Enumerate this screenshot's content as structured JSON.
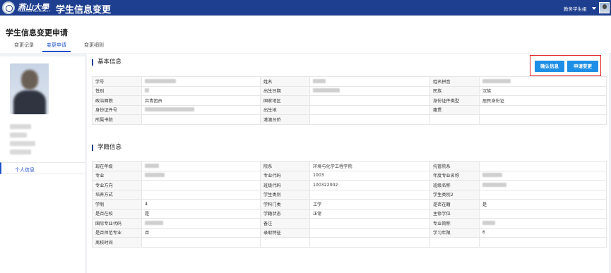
{
  "header": {
    "univ_name_cn": "燕山大學",
    "univ_name_en": "YANSHAN UNIVERSITY",
    "app_title": "学生信息变更",
    "role": "教务学生组"
  },
  "page": {
    "title": "学生信息变更申请",
    "tabs": [
      {
        "label": "变更记录"
      },
      {
        "label": "变更申请"
      },
      {
        "label": "变更细则"
      }
    ]
  },
  "left": {
    "menu_item": "个人信息"
  },
  "actions": {
    "confirm_label": "确认信息",
    "apply_label": "申请变更"
  },
  "basic": {
    "title": "基本信息",
    "rows": [
      [
        "学号",
        "",
        "姓名",
        "",
        "姓名拼音",
        ""
      ],
      [
        "性别",
        "",
        "出生日期",
        "",
        "民族",
        "汉族"
      ],
      [
        "政治面貌",
        "共青团员",
        "国家地区",
        "",
        "身份证件类型",
        "居民身份证"
      ],
      [
        "身份证件号",
        "",
        "出生地",
        "",
        "籍贯",
        ""
      ],
      [
        "所属书院",
        "",
        "港澳台侨",
        "",
        "",
        ""
      ]
    ]
  },
  "status": {
    "title": "学籍信息",
    "rows": [
      [
        "现在年级",
        "",
        "院系",
        "环境与化学工程学院",
        "托管院系",
        ""
      ],
      [
        "专业",
        "",
        "专业代码",
        "1003",
        "年度专业名称",
        ""
      ],
      [
        "专业方向",
        "",
        "班级代码",
        "100322002",
        "班级名称",
        ""
      ],
      [
        "培养方式",
        "",
        "学生类别",
        "",
        "学生类别2",
        ""
      ],
      [
        "学制",
        "4",
        "学科门类",
        "工学",
        "是否在籍",
        "是"
      ],
      [
        "是否在校",
        "是",
        "学籍状态",
        "正常",
        "主修学位",
        ""
      ],
      [
        "国际专业代码",
        "",
        "备注",
        "",
        "专业简称",
        ""
      ],
      [
        "是否师范专业",
        "否",
        "录取特征",
        "",
        "学习年限",
        "6"
      ],
      [
        "离校时间",
        "",
        "",
        "",
        "",
        ""
      ]
    ]
  },
  "colors": {
    "topbar": "#1e3f8f",
    "accent": "#1e50c8",
    "button": "#1e8fe6",
    "highlight_border": "#e02020"
  }
}
